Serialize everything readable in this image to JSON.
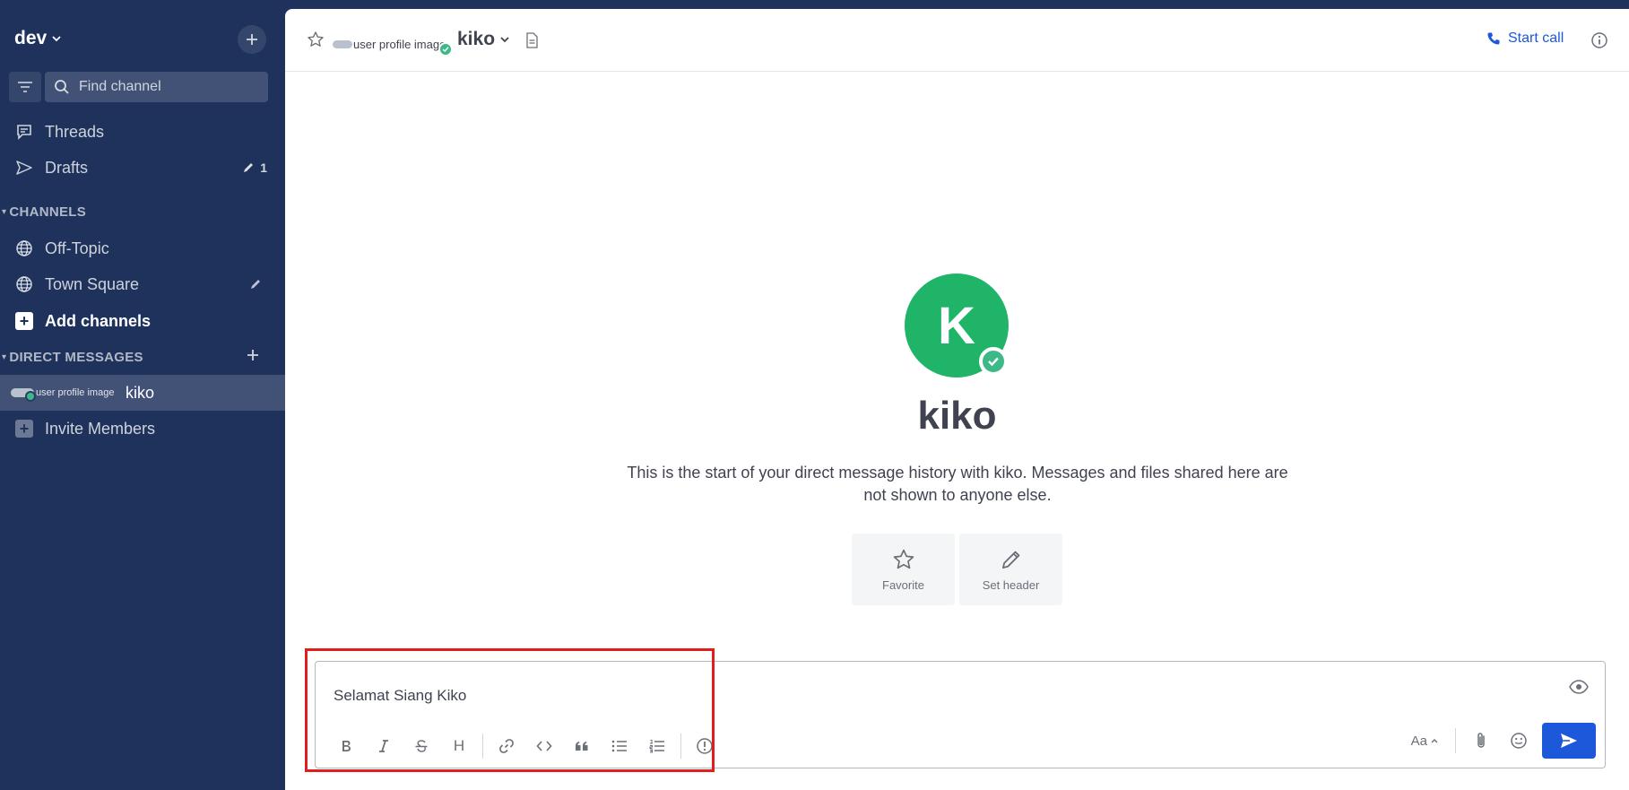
{
  "sidebar": {
    "team_name": "dev",
    "find_channel_placeholder": "Find channel",
    "threads_label": "Threads",
    "drafts_label": "Drafts",
    "drafts_count": "1",
    "channels_title": "CHANNELS",
    "channels": [
      {
        "label": "Off-Topic"
      },
      {
        "label": "Town Square"
      }
    ],
    "add_channels_label": "Add channels",
    "dm_title": "DIRECT MESSAGES",
    "dm_profile_alt": "user profile image",
    "dm_name": "kiko",
    "invite_label": "Invite Members"
  },
  "header": {
    "profile_alt": "user profile image",
    "channel_name": "kiko",
    "start_call_label": "Start call"
  },
  "intro": {
    "avatar_letter": "K",
    "name": "kiko",
    "description": "This is the start of your direct message history with kiko. Messages and files shared here are not shown to anyone else.",
    "favorite_label": "Favorite",
    "set_header_label": "Set header"
  },
  "composer": {
    "text": "Selamat Siang Kiko",
    "aa_label": "Aa",
    "heading_label": "H"
  },
  "colors": {
    "sidebar_bg": "#1e325c",
    "accent": "#1c58d9",
    "online": "#3db887",
    "avatar": "#1fb468",
    "highlight": "#e01e1e"
  }
}
